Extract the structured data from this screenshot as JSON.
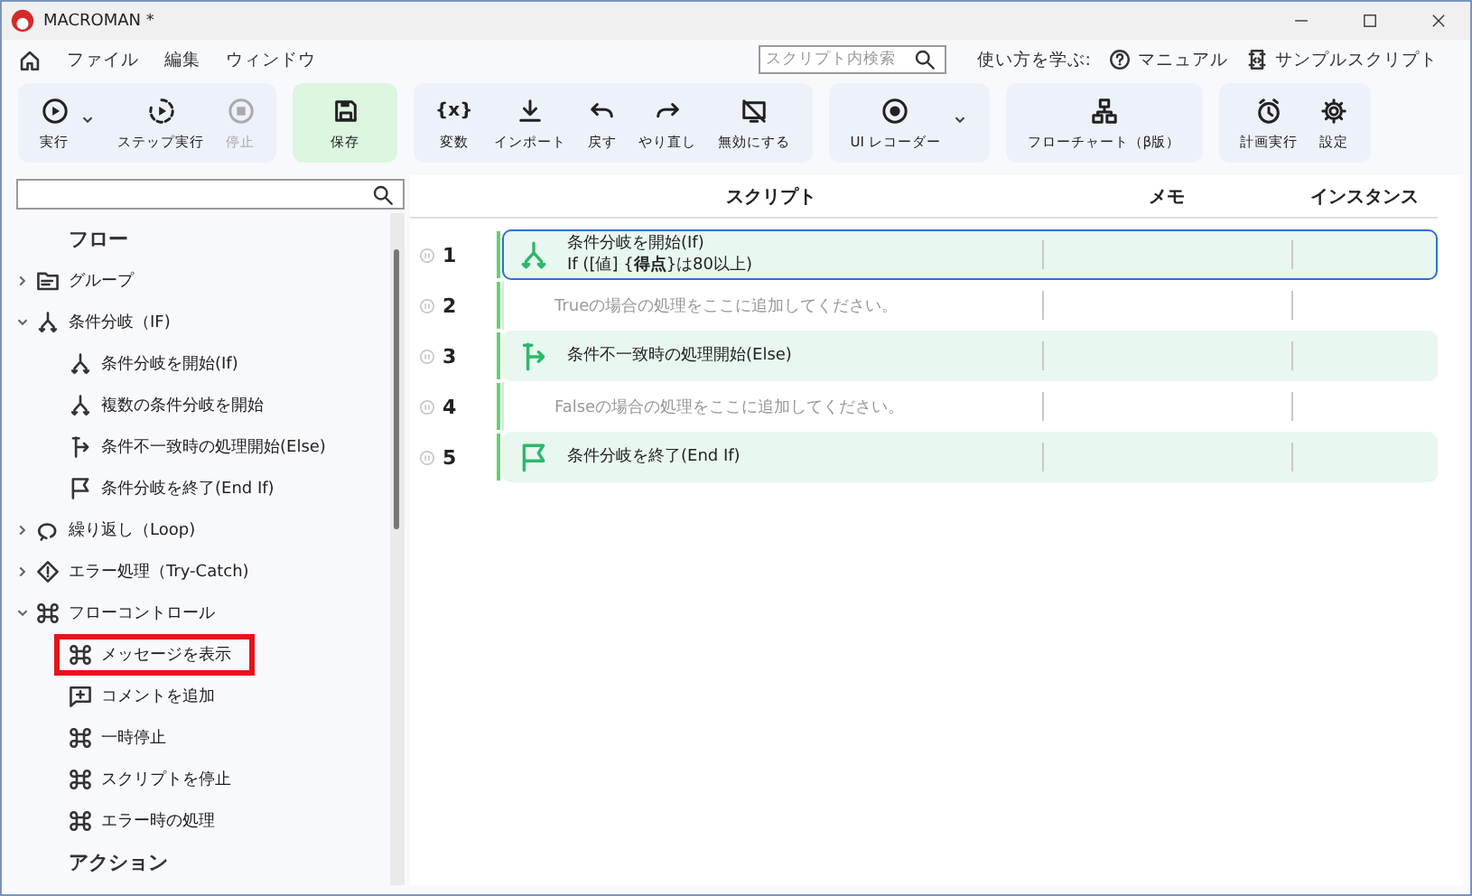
{
  "window": {
    "title": "MACROMAN *"
  },
  "menu": [
    "ファイル",
    "編集",
    "ウィンドウ"
  ],
  "search": {
    "placeholder": "スクリプト内検索"
  },
  "help": {
    "label": "使い方を学ぶ:",
    "links": [
      "マニュアル",
      "サンプルスクリプト"
    ]
  },
  "toolbar": [
    {
      "kind": "normal",
      "buttons": [
        {
          "label": "実行",
          "dropdown": true,
          "disabled": false
        },
        {
          "label": "ステップ実行",
          "dropdown": false,
          "disabled": false
        },
        {
          "label": "停止",
          "dropdown": false,
          "disabled": true
        }
      ]
    },
    {
      "kind": "accent",
      "buttons": [
        {
          "label": "保存",
          "dropdown": false,
          "disabled": false
        }
      ]
    },
    {
      "kind": "normal",
      "buttons": [
        {
          "glyph": "{x}",
          "label": "変数",
          "dropdown": false,
          "disabled": false
        },
        {
          "label": "インポート",
          "dropdown": false,
          "disabled": false
        },
        {
          "label": "戻す",
          "dropdown": false,
          "disabled": false
        },
        {
          "label": "やり直し",
          "dropdown": false,
          "disabled": false
        },
        {
          "label": "無効にする",
          "dropdown": false,
          "disabled": false
        }
      ]
    },
    {
      "kind": "normal",
      "buttons": [
        {
          "label": "UI レコーダー",
          "dropdown": true,
          "disabled": false
        }
      ]
    },
    {
      "kind": "normal",
      "buttons": [
        {
          "label": "フローチャート（β版）",
          "dropdown": false,
          "disabled": false
        }
      ]
    },
    {
      "kind": "normal",
      "buttons": [
        {
          "label": "計画実行",
          "dropdown": false,
          "disabled": false
        },
        {
          "label": "設定",
          "dropdown": false,
          "disabled": false
        }
      ]
    }
  ],
  "sidebar": {
    "sections": [
      {
        "heading": "フロー",
        "items": [
          {
            "label": "グループ",
            "expanded": false
          },
          {
            "label": "条件分岐（IF)",
            "expanded": true,
            "children": [
              {
                "label": "条件分岐を開始(If)",
                "highlighted": false
              },
              {
                "label": "複数の条件分岐を開始",
                "highlighted": false
              },
              {
                "label": "条件不一致時の処理開始(Else)",
                "highlighted": false
              },
              {
                "label": "条件分岐を終了(End If)",
                "highlighted": false
              }
            ]
          },
          {
            "label": "繰り返し（Loop)",
            "expanded": false
          },
          {
            "label": "エラー処理（Try-Catch)",
            "expanded": false
          },
          {
            "label": "フローコントロール",
            "expanded": true,
            "children": [
              {
                "label": "メッセージを表示",
                "highlighted": true
              },
              {
                "label": "コメントを追加",
                "highlighted": false
              },
              {
                "label": "一時停止",
                "highlighted": false
              },
              {
                "label": "スクリプトを停止",
                "highlighted": false
              },
              {
                "label": "エラー時の処理",
                "highlighted": false
              }
            ]
          }
        ]
      },
      {
        "heading": "アクション"
      }
    ]
  },
  "script": {
    "columns": [
      "スクリプト",
      "メモ",
      "インスタンス"
    ],
    "rows": [
      {
        "number": "1",
        "kind": "step",
        "text": "条件分岐を開始(If)",
        "detail": "If ([値] {**得点**}は80以上)",
        "selected": true
      },
      {
        "number": "2",
        "kind": "placeholder",
        "text": "Trueの場合の処理をここに追加してください。",
        "selected": false
      },
      {
        "number": "3",
        "kind": "step",
        "text": "条件不一致時の処理開始(Else)",
        "selected": false
      },
      {
        "number": "4",
        "kind": "placeholder",
        "text": "Falseの場合の処理をここに追加してください。",
        "selected": false
      },
      {
        "number": "5",
        "kind": "step",
        "text": "条件分岐を終了(End If)",
        "selected": false
      }
    ]
  }
}
